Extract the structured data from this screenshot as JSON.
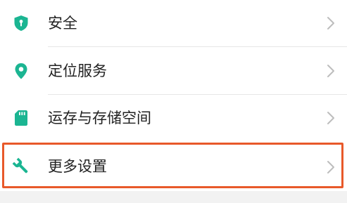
{
  "settings": {
    "items": [
      {
        "label": "安全",
        "icon": "shield-icon"
      },
      {
        "label": "定位服务",
        "icon": "location-pin-icon"
      },
      {
        "label": "运存与存储空间",
        "icon": "sd-card-icon"
      },
      {
        "label": "更多设置",
        "icon": "wrench-icon"
      }
    ],
    "highlighted_item": "更多设置"
  },
  "colors": {
    "icon_accent": "#1bb592",
    "highlight_border": "#e8592a",
    "label_text": "#222222",
    "chevron": "#bdbdbd",
    "divider": "#e6e6e6"
  }
}
